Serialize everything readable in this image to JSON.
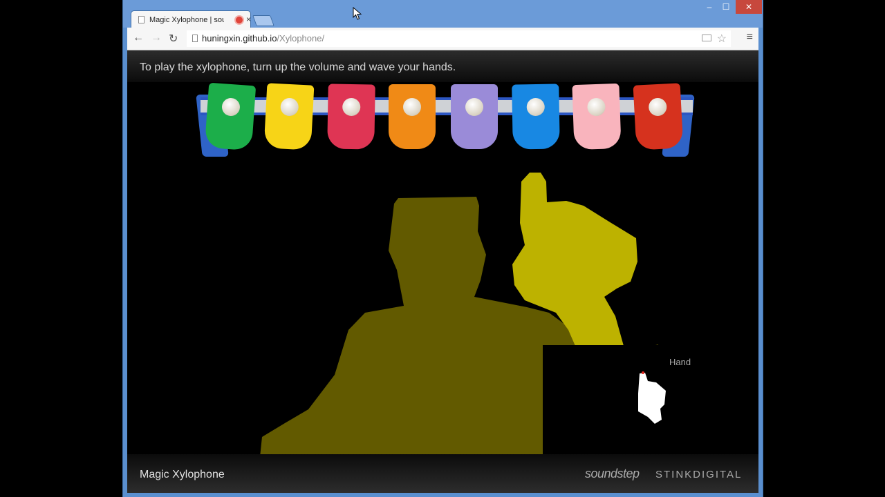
{
  "tab": {
    "title": "Magic Xylophone | sou"
  },
  "address": {
    "host": "huningxin.github.io",
    "path": "/Xylophone/"
  },
  "window_controls": {
    "minimize": "‒",
    "maximize": "☐",
    "close": "✕"
  },
  "page": {
    "instruction": "To play the xylophone, turn up the volume and wave your hands.",
    "hand_label": "Hand",
    "footer_title": "Magic Xylophone",
    "logo_soundstep": "soundstep",
    "logo_stink": "STINKDIGITAL"
  },
  "xylophone": {
    "key_colors": [
      "#1cae4a",
      "#f7d417",
      "#df3554",
      "#f08a16",
      "#9a8bd8",
      "#1888e3",
      "#f9b4bd",
      "#d6321e"
    ],
    "rail_color": "#2c56c2"
  }
}
